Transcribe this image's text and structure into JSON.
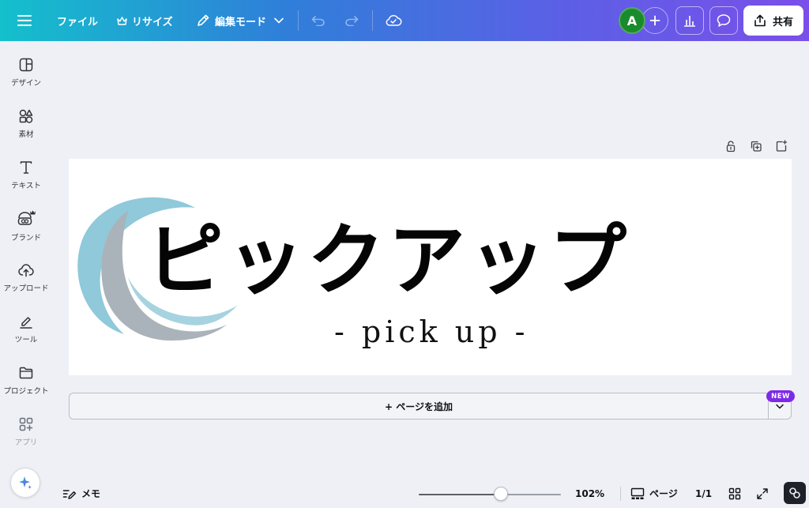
{
  "topbar": {
    "file_label": "ファイル",
    "resize_label": "リサイズ",
    "edit_mode_label": "編集モード",
    "avatar_initial": "A",
    "share_label": "共有"
  },
  "sidebar": {
    "items": [
      {
        "label": "デザイン",
        "icon": "design-icon"
      },
      {
        "label": "素材",
        "icon": "elements-icon"
      },
      {
        "label": "テキスト",
        "icon": "text-icon"
      },
      {
        "label": "ブランド",
        "icon": "brand-icon"
      },
      {
        "label": "アップロード",
        "icon": "upload-icon"
      },
      {
        "label": "ツール",
        "icon": "tools-icon"
      },
      {
        "label": "プロジェクト",
        "icon": "folder-icon"
      },
      {
        "label": "アプリ",
        "icon": "apps-icon"
      }
    ]
  },
  "canvas": {
    "headline": "ピックアップ",
    "subline": "- pick up -",
    "arc_colors": [
      "#8fc9da",
      "#aab3ba",
      "#a6d3df"
    ]
  },
  "add_page": {
    "label": "+ ページを追加",
    "badge": "NEW"
  },
  "bottombar": {
    "memo_label": "メモ",
    "zoom_value": "102%",
    "zoom_fraction": 0.58,
    "pages_label": "ページ",
    "page_count": "1/1"
  },
  "colors": {
    "gradient_start": "#14c0cc",
    "gradient_end": "#7a4fe9",
    "avatar": "#1a8b2c",
    "badge": "#7d2ae8"
  }
}
